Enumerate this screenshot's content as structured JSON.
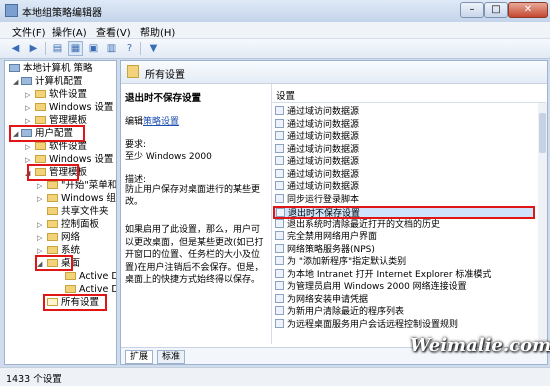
{
  "window": {
    "title": "本地组策略编辑器"
  },
  "menu": [
    "文件(F)",
    "操作(A)",
    "查看(V)",
    "帮助(H)"
  ],
  "tree": {
    "items": [
      "本地计算机 策略",
      "计算机配置",
      "软件设置",
      "Windows 设置",
      "管理模板",
      "用户配置",
      "软件设置",
      "Windows 设置",
      "管理模板",
      "\"开始\"菜单和",
      "Windows 组件",
      "共享文件夹",
      "控制面板",
      "网络",
      "系统",
      "桌面",
      "Active Des",
      "Active Dir",
      "所有设置"
    ]
  },
  "right": {
    "header_title": "所有设置",
    "desc": {
      "heading": "退出时不保存设置",
      "edit_prefix": "编辑",
      "edit_link": "策略设置",
      "req_label": "要求:",
      "req_value": "至少 Windows 2000",
      "desc_label": "描述:",
      "desc_text": "防止用户保存对桌面进行的某些更改。",
      "detail": "如果启用了此设置，那么，用户可以更改桌面，但是某些更改(如已打开窗口的位置、任务栏的大小及位置)在用户注销后不会保存。但是，桌面上的快捷方式始终得以保存。"
    },
    "list_header": "设置",
    "rows": [
      "通过域访问数据源",
      "通过域访问数据源",
      "通过域访问数据源",
      "通过域访问数据源",
      "通过域访问数据源",
      "通过域访问数据源",
      "通过域访问数据源",
      "同步运行登录脚本",
      "退出时不保存设置",
      "退出系统时清除最近打开的文档的历史",
      "完全禁用网络用户界面",
      "网络策略服务器(NPS)",
      "为 \"添加新程序\"指定默认类别",
      "为本地 Intranet 打开 Internet Explorer 标准模式",
      "为管理员启用 Windows 2000 网络连接设置",
      "为网络安装申请凭据",
      "为新用户清除最近的程序列表",
      "为远程桌面服务用户会话远程控制设置规则"
    ],
    "tabs": [
      "扩展",
      "标准"
    ]
  },
  "status": {
    "text": "1433 个设置"
  },
  "watermark": "Weimalie.com",
  "colors": {
    "highlight_border": "#e01616",
    "selected_row": "#cfe3fa"
  }
}
